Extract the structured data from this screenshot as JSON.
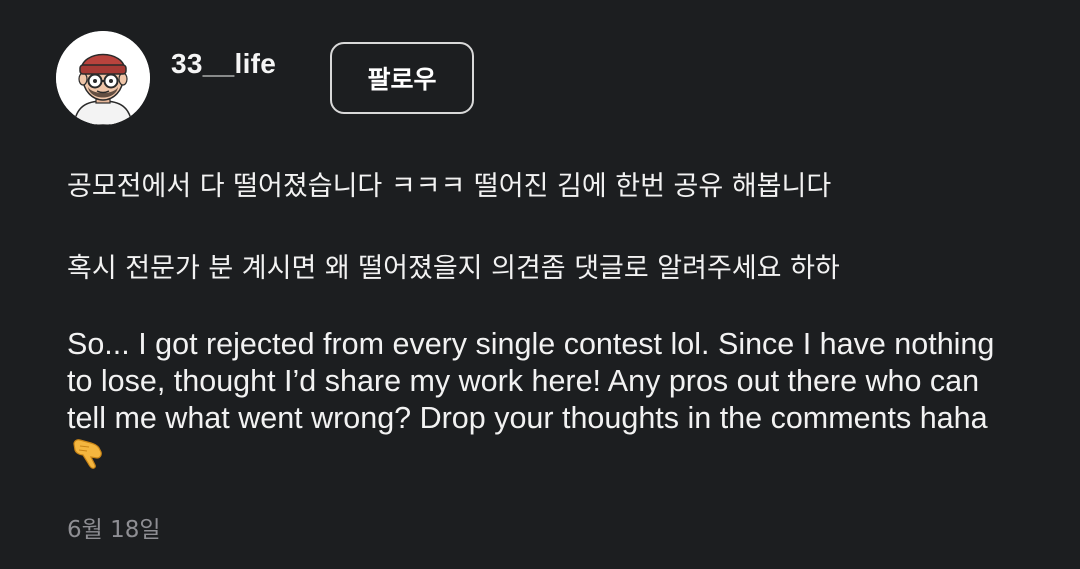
{
  "post": {
    "username": "33__life",
    "follow_label": "팔로우",
    "paragraph_ko_1": "공모전에서 다 떨어졌습니다 ㅋㅋㅋ 떨어진 김에 한번 공유 해봅니다",
    "paragraph_ko_2": "혹시 전문가 분 계시면 왜 떨어졌을지 의견좀 댓글로 알려주세요 하하",
    "paragraph_en": "So... I got rejected from every single contest lol. Since I have nothing to lose, thought I’d share my work here! Any pros out there who can tell me what went wrong? Drop your thoughts in the comments haha",
    "emoji_icon": "backhand-index-pointing-down-icon",
    "date": "6월 18일"
  },
  "colors": {
    "background": "#1c1e20",
    "text": "#f2f2f2",
    "muted": "#8e8e93",
    "button_border": "#d9d9d9"
  }
}
